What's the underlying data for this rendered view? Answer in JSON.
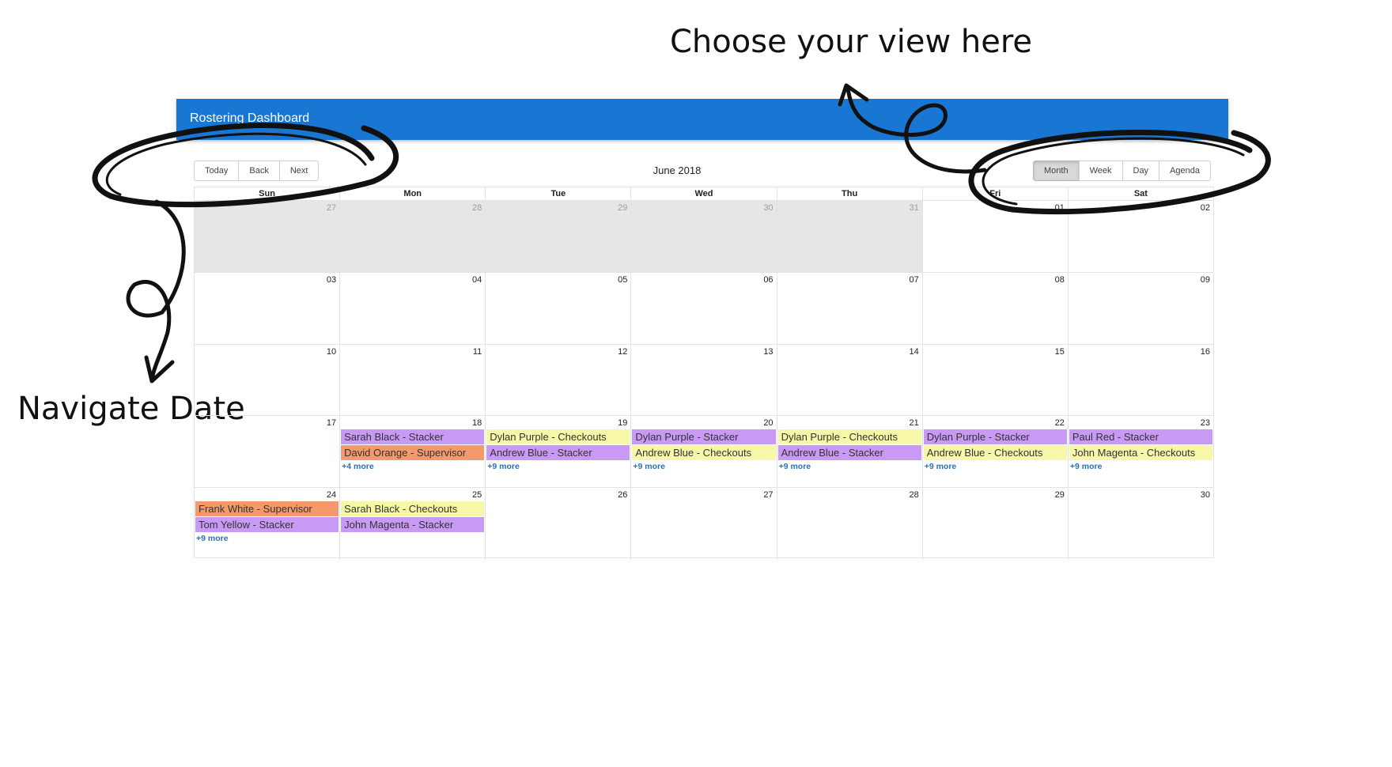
{
  "annotations": {
    "view": "Choose your view here",
    "navigate": "Navigate Date"
  },
  "app": {
    "title": "Rostering Dashboard"
  },
  "toolbar": {
    "label": "June 2018",
    "nav": [
      "Today",
      "Back",
      "Next"
    ],
    "views": [
      "Month",
      "Week",
      "Day",
      "Agenda"
    ],
    "active_view": "Month"
  },
  "weekdays": [
    "Sun",
    "Mon",
    "Tue",
    "Wed",
    "Thu",
    "Fri",
    "Sat"
  ],
  "colors": {
    "header": "#1976d2",
    "purple": "#c89af5",
    "orange": "#f4996c",
    "yellow": "#f7f7a8",
    "more_link": "#2d6fb3",
    "off_range": "#e6e6e6"
  },
  "weeks": [
    {
      "days": [
        {
          "date": "27",
          "off": true,
          "events": []
        },
        {
          "date": "28",
          "off": true,
          "events": []
        },
        {
          "date": "29",
          "off": true,
          "events": []
        },
        {
          "date": "30",
          "off": true,
          "events": []
        },
        {
          "date": "31",
          "off": true,
          "events": []
        },
        {
          "date": "01",
          "off": false,
          "events": []
        },
        {
          "date": "02",
          "off": false,
          "events": []
        }
      ]
    },
    {
      "days": [
        {
          "date": "03",
          "events": []
        },
        {
          "date": "04",
          "events": []
        },
        {
          "date": "05",
          "events": []
        },
        {
          "date": "06",
          "events": []
        },
        {
          "date": "07",
          "events": []
        },
        {
          "date": "08",
          "events": []
        },
        {
          "date": "09",
          "events": []
        }
      ]
    },
    {
      "days": [
        {
          "date": "10",
          "events": []
        },
        {
          "date": "11",
          "events": []
        },
        {
          "date": "12",
          "events": []
        },
        {
          "date": "13",
          "events": []
        },
        {
          "date": "14",
          "events": []
        },
        {
          "date": "15",
          "events": []
        },
        {
          "date": "16",
          "events": []
        }
      ]
    },
    {
      "days": [
        {
          "date": "17",
          "events": []
        },
        {
          "date": "18",
          "events": [
            {
              "title": "Sarah Black - Stacker",
              "color": "purple"
            },
            {
              "title": "David Orange - Supervisor",
              "color": "orange"
            }
          ],
          "more": "+4 more"
        },
        {
          "date": "19",
          "events": [
            {
              "title": "Dylan Purple - Checkouts",
              "color": "yellow"
            },
            {
              "title": "Andrew Blue - Stacker",
              "color": "purple"
            }
          ],
          "more": "+9 more"
        },
        {
          "date": "20",
          "events": [
            {
              "title": "Dylan Purple - Stacker",
              "color": "purple"
            },
            {
              "title": "Andrew Blue - Checkouts",
              "color": "yellow"
            }
          ],
          "more": "+9 more"
        },
        {
          "date": "21",
          "events": [
            {
              "title": "Dylan Purple - Checkouts",
              "color": "yellow"
            },
            {
              "title": "Andrew Blue - Stacker",
              "color": "purple"
            }
          ],
          "more": "+9 more"
        },
        {
          "date": "22",
          "events": [
            {
              "title": "Dylan Purple - Stacker",
              "color": "purple"
            },
            {
              "title": "Andrew Blue - Checkouts",
              "color": "yellow"
            }
          ],
          "more": "+9 more"
        },
        {
          "date": "23",
          "events": [
            {
              "title": "Paul Red - Stacker",
              "color": "purple"
            },
            {
              "title": "John Magenta - Checkouts",
              "color": "yellow"
            }
          ],
          "more": "+9 more"
        }
      ]
    },
    {
      "days": [
        {
          "date": "24",
          "events": [
            {
              "title": "Frank White - Supervisor",
              "color": "orange"
            },
            {
              "title": "Tom Yellow - Stacker",
              "color": "purple"
            }
          ],
          "more": "+9 more"
        },
        {
          "date": "25",
          "events": [
            {
              "title": "Sarah Black - Checkouts",
              "color": "yellow"
            },
            {
              "title": "John Magenta - Stacker",
              "color": "purple"
            }
          ]
        },
        {
          "date": "26",
          "events": []
        },
        {
          "date": "27",
          "events": []
        },
        {
          "date": "28",
          "events": []
        },
        {
          "date": "29",
          "events": []
        },
        {
          "date": "30",
          "events": []
        }
      ]
    }
  ]
}
